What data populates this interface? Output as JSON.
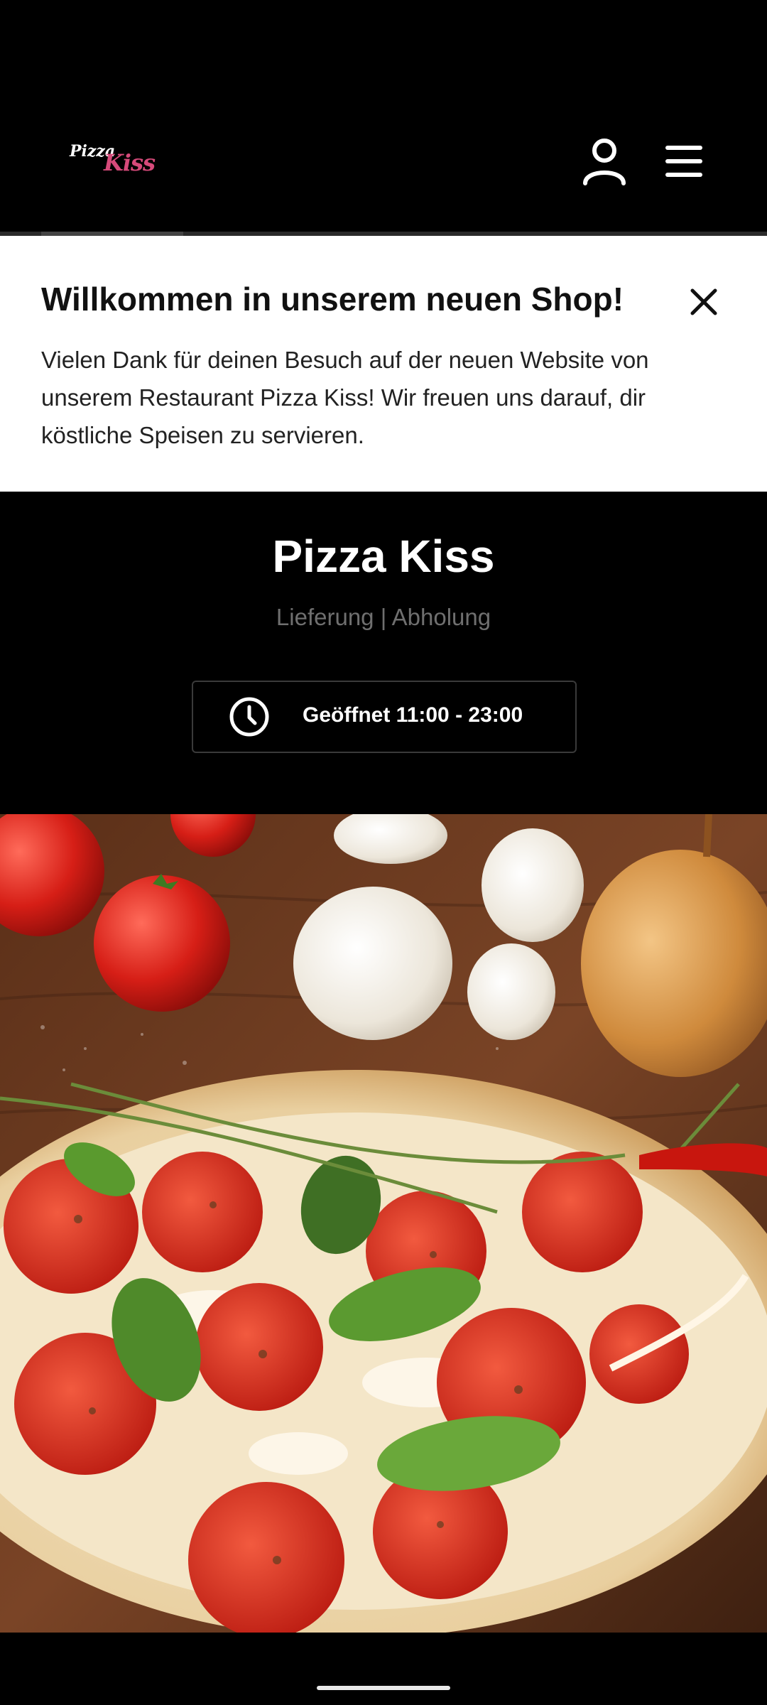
{
  "header": {
    "logo_pizza": "Pizza",
    "logo_kiss": "Kiss",
    "account_icon": "user-icon",
    "menu_icon": "hamburger-menu-icon"
  },
  "banner": {
    "title": "Willkommen in unserem neuen Shop!",
    "text": "Vielen Dank für deinen Besuch auf der neuen Website von unserem Restaurant Pizza Kiss! Wir freuen uns darauf, dir köstliche Speisen zu servieren.",
    "close_icon": "close-icon"
  },
  "restaurant": {
    "name": "Pizza Kiss",
    "service_types": "Lieferung | Abholung",
    "hours": "Geöffnet 11:00 - 23:00",
    "hours_icon": "clock-icon"
  },
  "colors": {
    "background": "#000000",
    "banner_background": "#ffffff",
    "brand_accent": "#d64a7a",
    "muted_text": "#6f6f6f"
  }
}
